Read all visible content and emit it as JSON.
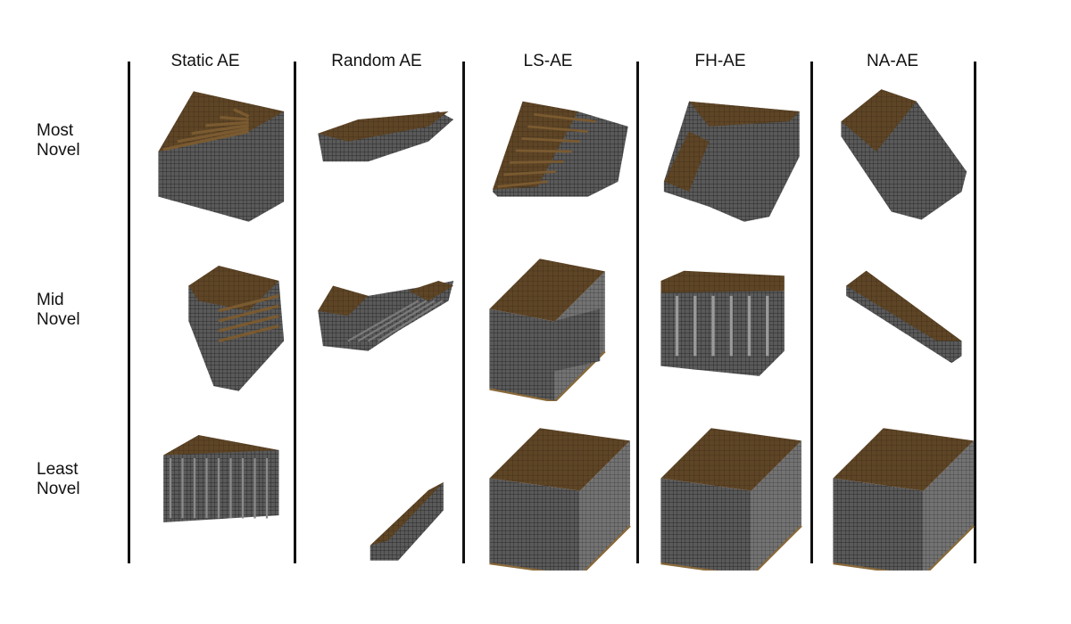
{
  "columns": [
    "Static AE",
    "Random AE",
    "LS-AE",
    "FH-AE",
    "NA-AE"
  ],
  "rows": [
    {
      "line1": "Most",
      "line2": "Novel"
    },
    {
      "line1": "Mid",
      "line2": "Novel"
    },
    {
      "line1": "Least",
      "line2": "Novel"
    }
  ],
  "colors": {
    "top_face": "#5e4526",
    "side_face": "#5a5a5a",
    "grid_line": "#2a2a2a",
    "edge_accent": "#8a6a3a",
    "divider": "#111111"
  }
}
